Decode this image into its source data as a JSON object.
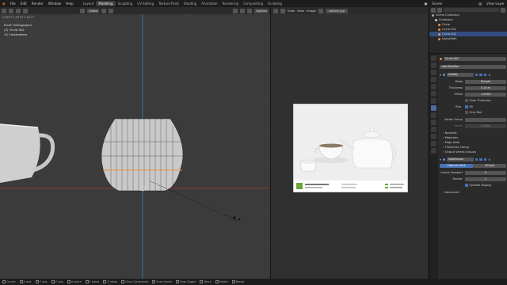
{
  "menu": [
    "File",
    "Edit",
    "Render",
    "Window",
    "Help"
  ],
  "workspaces": [
    "Layout",
    "Modeling",
    "Sculpting",
    "UV Editing",
    "Texture Paint",
    "Shading",
    "Animation",
    "Rendering",
    "Compositing",
    "Scripting"
  ],
  "active_workspace": "Modeling",
  "scene_label": "Scene",
  "view_layer_label": "View Layer",
  "viewport": {
    "orientation": "Global",
    "ruler": "1.0177   1.0177   1.0177",
    "info_line1": "Front Orthographic",
    "info_line2": "(3) Circle.002",
    "info_line3": "10 Centimeters",
    "options_label": "Options"
  },
  "image_editor": {
    "view_label": "View",
    "view2_label": "View",
    "image_label": "Image",
    "filename": "valhom.jpg",
    "photo_strip_title": "Ceramic Teapot Set"
  },
  "outliner": {
    "rows": [
      {
        "label": "Scene Collection",
        "selected": false
      },
      {
        "label": "Collection",
        "selected": false
      },
      {
        "label": "Circle",
        "selected": false
      },
      {
        "label": "Circle.001",
        "selected": false
      },
      {
        "label": "Circle.002",
        "selected": true
      },
      {
        "label": "NurbsPath",
        "selected": false
      }
    ]
  },
  "properties": {
    "object_name": "Circle.002",
    "add_modifier": "Add Modifier",
    "solidify": {
      "name": "Solidify",
      "mode_label": "Mode",
      "mode_value": "Simple",
      "thickness_label": "Thickness",
      "thickness_value": "0.19 m",
      "offset_label": "Offset",
      "offset_value": "1.0000",
      "even_thickness": "Even Thickness",
      "rim_label": "Rim",
      "fill_label": "Fill",
      "only_rim_label": "Only Rim",
      "vertex_group_label": "Vertex Group",
      "factor_label": "Factor",
      "factor_value": "0.0000",
      "sections": [
        "Normals",
        "Materials",
        "Edge Data",
        "Thickness Clamp",
        "Output Vertex Groups"
      ]
    },
    "subsurf": {
      "name": "Subdivision",
      "tab_catmull": "Catmull-Clark",
      "tab_simple": "Simple",
      "levels_label": "Levels Viewport",
      "levels_value": "0",
      "render_label": "Render",
      "render_value": "2",
      "optimal_label": "Optimal Display",
      "advanced_label": "Advanced"
    }
  },
  "statusbar": [
    "Cancel",
    "X axis",
    "Y axis",
    "Z axis",
    "X plane",
    "Y plane",
    "Z plane",
    "Clear Constraints",
    "Snap Invert",
    "Snap Toggle",
    "Move",
    "Rotate",
    "Resize"
  ]
}
